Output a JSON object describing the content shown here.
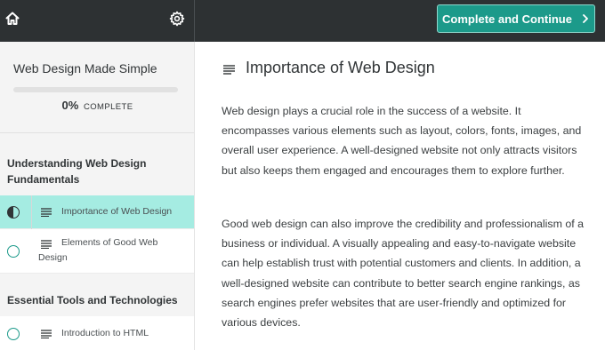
{
  "topbar": {
    "home_label": "Home",
    "settings_label": "Settings",
    "cta_label": "Complete and Continue"
  },
  "sidebar": {
    "course_title": "Web Design Made Simple",
    "progress_percent": "0%",
    "progress_word": "COMPLETE",
    "progress_value": 0,
    "sections": [
      {
        "title": "Understanding Web Design Fundamentals",
        "lessons": [
          {
            "label": "Importance of Web Design",
            "status": "in-progress",
            "active": true
          },
          {
            "label": "Elements of Good Web Design",
            "status": "not-started",
            "active": false
          }
        ]
      },
      {
        "title": "Essential Tools and Technologies",
        "lessons": [
          {
            "label": "Introduction to HTML",
            "status": "not-started",
            "active": false
          }
        ]
      }
    ]
  },
  "main": {
    "lesson_title": "Importance of Web Design",
    "paragraphs": [
      "Web design plays a crucial role in the success of a website. It encompasses various elements such as layout, colors, fonts, images, and overall user experience. A well-designed website not only attracts visitors but also keeps them engaged and encourages them to explore further.",
      "Good web design can also improve the credibility and professionalism of a business or individual. A visually appealing and easy-to-navigate website can help establish trust with potential customers and clients. In addition, a well-designed website can contribute to better search engine rankings, as search engines prefer websites that are user-friendly and optimized for various devices."
    ]
  },
  "colors": {
    "topbar": "#2d3133",
    "accent": "#1c9a8a",
    "active_lesson": "#a5ece2",
    "sidebar_bg": "#f4f4f4"
  }
}
